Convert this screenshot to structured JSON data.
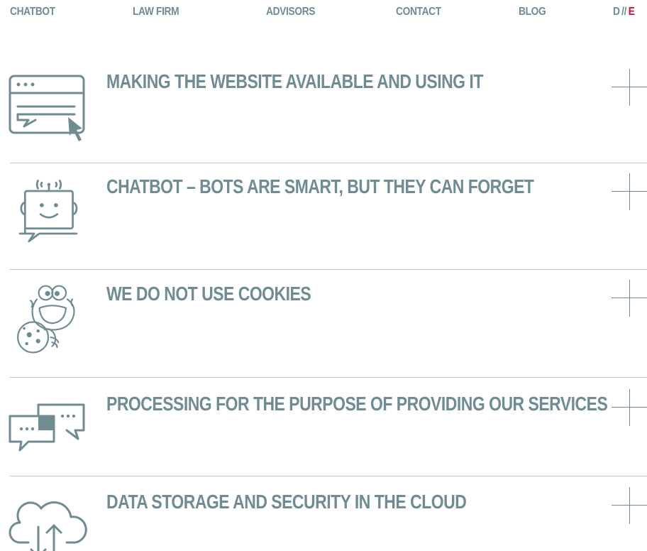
{
  "nav": {
    "items": [
      {
        "label": "CHATBOT"
      },
      {
        "label": "LAW FIRM"
      },
      {
        "label": "ADVISORS"
      },
      {
        "label": "CONTACT"
      },
      {
        "label": "BLOG"
      }
    ],
    "lang": {
      "d": "D",
      "sep": "//",
      "e": "E"
    }
  },
  "sections": [
    {
      "title": "MAKING THE WEBSITE AVAILABLE AND USING IT",
      "icon": "browser-window-cursor-icon"
    },
    {
      "title": "CHATBOT – BOTS ARE SMART, BUT THEY CAN FORGET",
      "icon": "robot-chat-icon"
    },
    {
      "title": "WE DO NOT USE COOKIES",
      "icon": "cookie-monster-icon"
    },
    {
      "title": "PROCESSING FOR THE PURPOSE OF PROVIDING OUR SERVICES",
      "icon": "chat-bubbles-icon"
    },
    {
      "title": "DATA STORAGE AND SECURITY IN THE CLOUD",
      "icon": "cloud-sync-icon"
    }
  ],
  "colors": {
    "primary": "#6e8c92",
    "accent": "#c8102e",
    "divider": "#b9c9cc",
    "background": "#ffffff"
  }
}
